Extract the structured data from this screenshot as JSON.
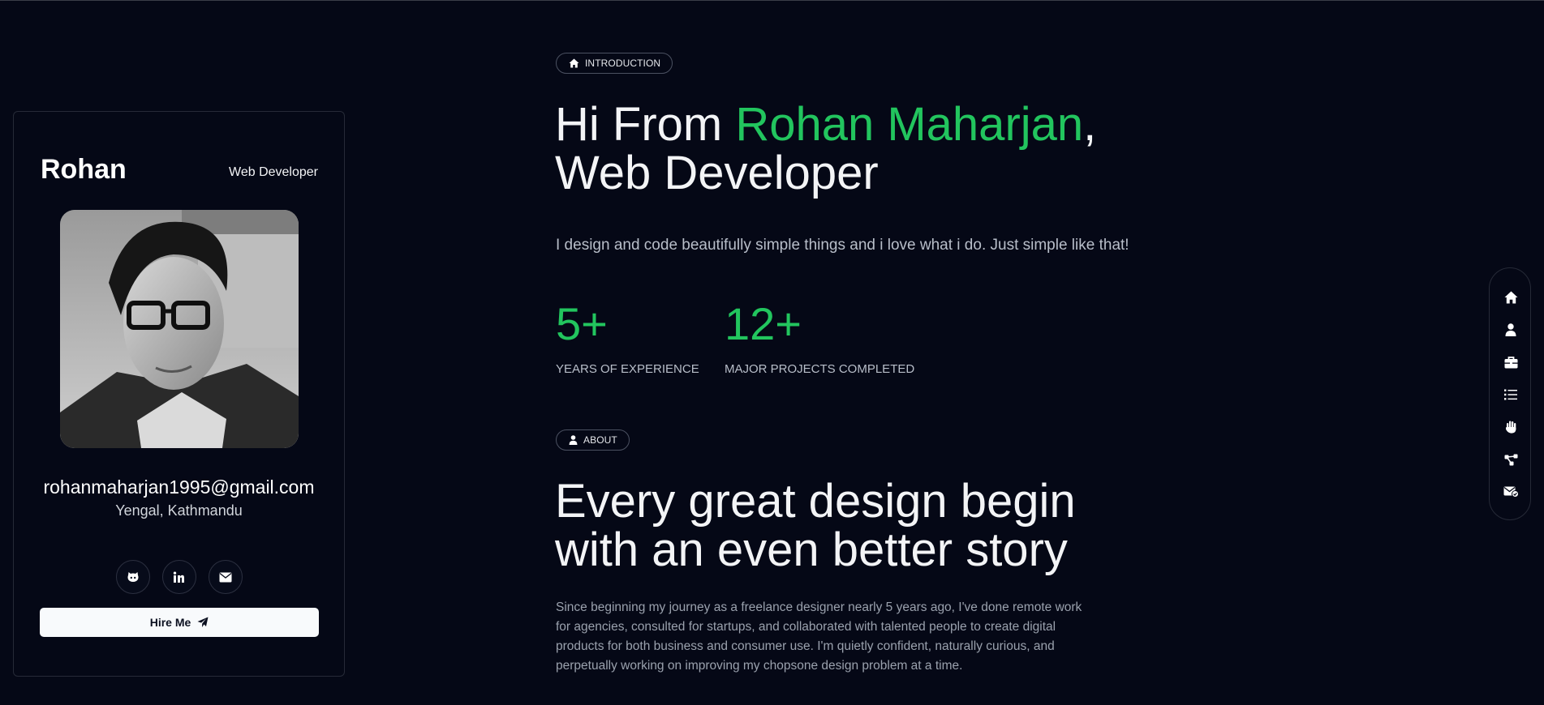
{
  "profile": {
    "name": "Rohan",
    "role": "Web Developer",
    "email": "rohanmaharjan1995@gmail.com",
    "location": "Yengal, Kathmandu",
    "socials": [
      "github-icon",
      "linkedin-icon",
      "email-icon"
    ],
    "hire_label": "Hire Me"
  },
  "intro": {
    "badge": "INTRODUCTION",
    "greeting_prefix": "Hi From ",
    "name": "Rohan Maharjan",
    "comma": ",",
    "title_line2": "Web Developer",
    "description": "I design and code beautifully simple things and i love what i do. Just simple like that!"
  },
  "stats": [
    {
      "number": "5+",
      "label": "YEARS OF EXPERIENCE"
    },
    {
      "number": "12+",
      "label": "MAJOR PROJECTS COMPLETED"
    }
  ],
  "about": {
    "badge": "ABOUT",
    "title_line1": "Every great design begin",
    "title_line2": "with an even better story",
    "text": "Since beginning my journey as a freelance designer nearly 5 years ago, I've done remote work for agencies, consulted for startups, and collaborated with talented people to create digital products for both business and consumer use. I'm quietly confident, naturally curious, and perpetually working on improving my chopsone design problem at a time."
  },
  "sidenav": [
    "home-icon",
    "user-icon",
    "briefcase-icon",
    "list-icon",
    "hand-icon",
    "share-nodes-icon",
    "envelope-check-icon"
  ],
  "colors": {
    "background": "#050816",
    "accent": "#22c55e",
    "text": "#f3f4f6",
    "muted": "#9aa1ad"
  }
}
